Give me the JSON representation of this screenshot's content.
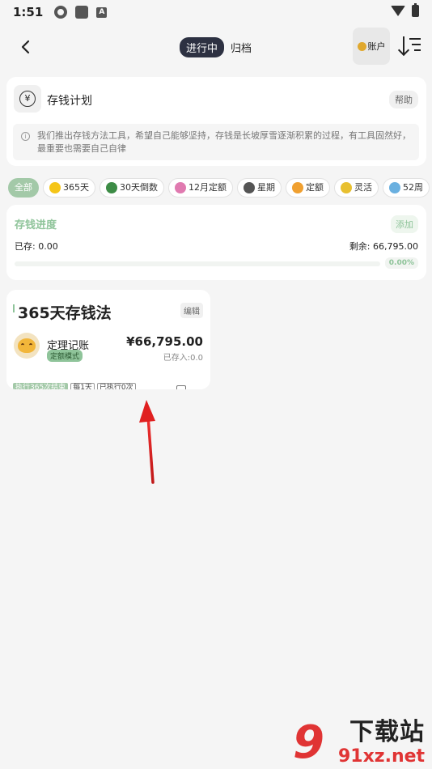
{
  "status_bar": {
    "time": "1:51",
    "badge_letter": "A"
  },
  "header": {
    "tab_active": "进行中",
    "tab_archive": "归档",
    "account_label": "账户"
  },
  "plan": {
    "title": "存钱计划",
    "help_label": "帮助",
    "tip": "我们推出存钱方法工具，希望自己能够坚持，存钱是长坡厚雪逐渐积累的过程，有工具固然好，最重要也需要自己自律"
  },
  "filters": [
    {
      "label": "全部",
      "active": true,
      "emoji": null
    },
    {
      "label": "365天",
      "active": false,
      "emoji": "#f5c518"
    },
    {
      "label": "30天倒数",
      "active": false,
      "emoji": "#3d8c46"
    },
    {
      "label": "12月定额",
      "active": false,
      "emoji": "#e07ab0"
    },
    {
      "label": "星期",
      "active": false,
      "emoji": "#555555"
    },
    {
      "label": "定额",
      "active": false,
      "emoji": "#f0a030"
    },
    {
      "label": "灵活",
      "active": false,
      "emoji": "#e8c030"
    },
    {
      "label": "52周",
      "active": false,
      "emoji": "#6ab0e0"
    },
    {
      "label": "",
      "active": false,
      "emoji": "#d09a20"
    }
  ],
  "progress": {
    "title": "存钱进度",
    "add_label": "添加",
    "saved": "已存: 0.00",
    "remaining": "剩余: 66,795.00",
    "percent_label": "0.00%",
    "percent_value": 0
  },
  "method_card": {
    "title": "365天存钱法",
    "edit_label": "编辑",
    "name": "定理记账",
    "mode": "定额模式",
    "amount": "¥66,795.00",
    "deposited": "已存入:0.0",
    "tags": [
      "执行365次结束",
      "每1天",
      "已执行0次"
    ]
  },
  "watermark": {
    "title": "下载站",
    "url": "91xz.net",
    "digit": "9"
  },
  "colors": {
    "accent": "#8fc49a",
    "tab_active_bg": "#2d3142",
    "annotation_arrow": "#e02020"
  }
}
